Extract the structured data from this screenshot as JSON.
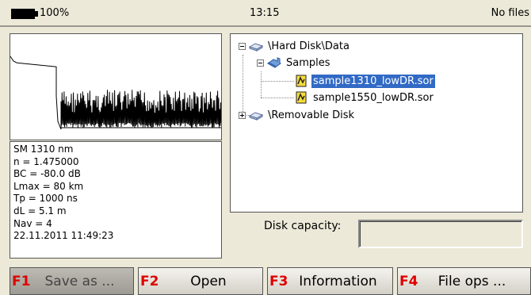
{
  "status_bar": {
    "battery": "100%",
    "time": "13:15",
    "files_status": "No files"
  },
  "info_panel": {
    "lines": [
      "SM 1310 nm",
      "n = 1.475000",
      "BC = -80.0 dB",
      "Lmax = 80 km",
      "Tp = 1000 ns",
      "dL = 5.1 m",
      "Nav = 4",
      "22.11.2011   11:49:23"
    ]
  },
  "tree": {
    "root": "\\Hard Disk\\Data",
    "folder": "Samples",
    "files": [
      "sample1310_lowDR.sor",
      "sample1550_lowDR.sor"
    ],
    "removable": "\\Removable Disk"
  },
  "disk": {
    "label": "Disk capacity:",
    "value": ""
  },
  "fkeys": [
    {
      "key": "F1",
      "label": "Save as ..."
    },
    {
      "key": "F2",
      "label": "Open"
    },
    {
      "key": "F3",
      "label": "Information"
    },
    {
      "key": "F4",
      "label": "File ops ..."
    }
  ],
  "colors": {
    "selection": "#316ac5",
    "fkey_number": "#e00000"
  },
  "icons": [
    "battery-icon",
    "drive-icon",
    "folder-icon",
    "sor-file-icon",
    "expand-minus-icon",
    "expand-plus-icon"
  ]
}
